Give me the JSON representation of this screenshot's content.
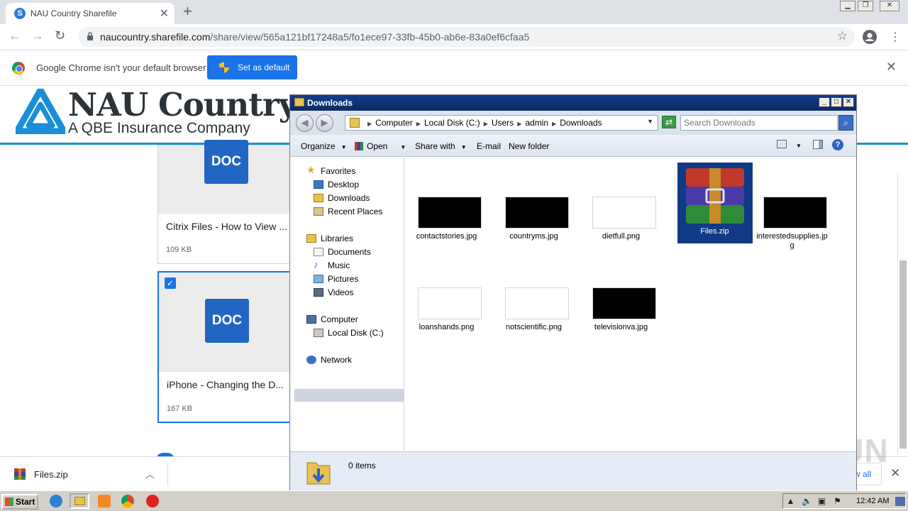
{
  "browser": {
    "tab_title": "NAU Country Sharefile",
    "tab_close": "✕",
    "new_tab": "+",
    "url_host": "naucountry.sharefile.com",
    "url_path": "/share/view/565a121bf17248a5/fo1ece97-33fb-45b0-ab6e-83a0ef6cfaa5"
  },
  "infobar": {
    "message": "Google Chrome isn't your default browser",
    "button": "Set as default"
  },
  "page": {
    "logo_name": "NAU Country",
    "logo_tagline": "A QBE Insurance Company",
    "cards": [
      {
        "icon_text": "DOC",
        "name": "Citrix Files - How to View ...",
        "size": "109 KB",
        "selected": false
      },
      {
        "icon_text": "DOC",
        "name": "iPhone - Changing the D...",
        "size": "167 KB",
        "selected": true
      }
    ]
  },
  "downloads_shelf": {
    "file": "Files.zip",
    "show_all": "w all"
  },
  "explorer": {
    "title": "Downloads",
    "breadcrumb": [
      "Computer",
      "Local Disk (C:)",
      "Users",
      "admin",
      "Downloads"
    ],
    "search_placeholder": "Search Downloads",
    "commands": {
      "organize": "Organize",
      "open": "Open",
      "share_with": "Share with",
      "email": "E-mail",
      "new_folder": "New folder"
    },
    "nav": {
      "favorites": "Favorites",
      "desktop": "Desktop",
      "downloads": "Downloads",
      "recent_places": "Recent Places",
      "libraries": "Libraries",
      "documents": "Documents",
      "music": "Music",
      "pictures": "Pictures",
      "videos": "Videos",
      "computer": "Computer",
      "local_disk": "Local Disk (C:)",
      "network": "Network"
    },
    "files": [
      {
        "name": "contactstories.jpg",
        "thumb": "dark"
      },
      {
        "name": "countryms.jpg",
        "thumb": "dark"
      },
      {
        "name": "dietfull.png",
        "thumb": "light"
      },
      {
        "name": "Files.zip",
        "thumb": "archive",
        "selected": true
      },
      {
        "name": "interestedsupplies.jpg",
        "thumb": "dark"
      },
      {
        "name": "loanshands.png",
        "thumb": "light"
      },
      {
        "name": "notscientific.png",
        "thumb": "light"
      },
      {
        "name": "televisionva.jpg",
        "thumb": "dark"
      }
    ],
    "status": "0 items"
  },
  "taskbar": {
    "start": "Start",
    "clock": "12:42 AM"
  },
  "watermark": "ANY RUN",
  "colors": {
    "chrome_blue": "#1a73e8",
    "explorer_title": "#0b2a67",
    "brand_rule": "#1a8fd8",
    "doc_icon": "#2266c4"
  }
}
